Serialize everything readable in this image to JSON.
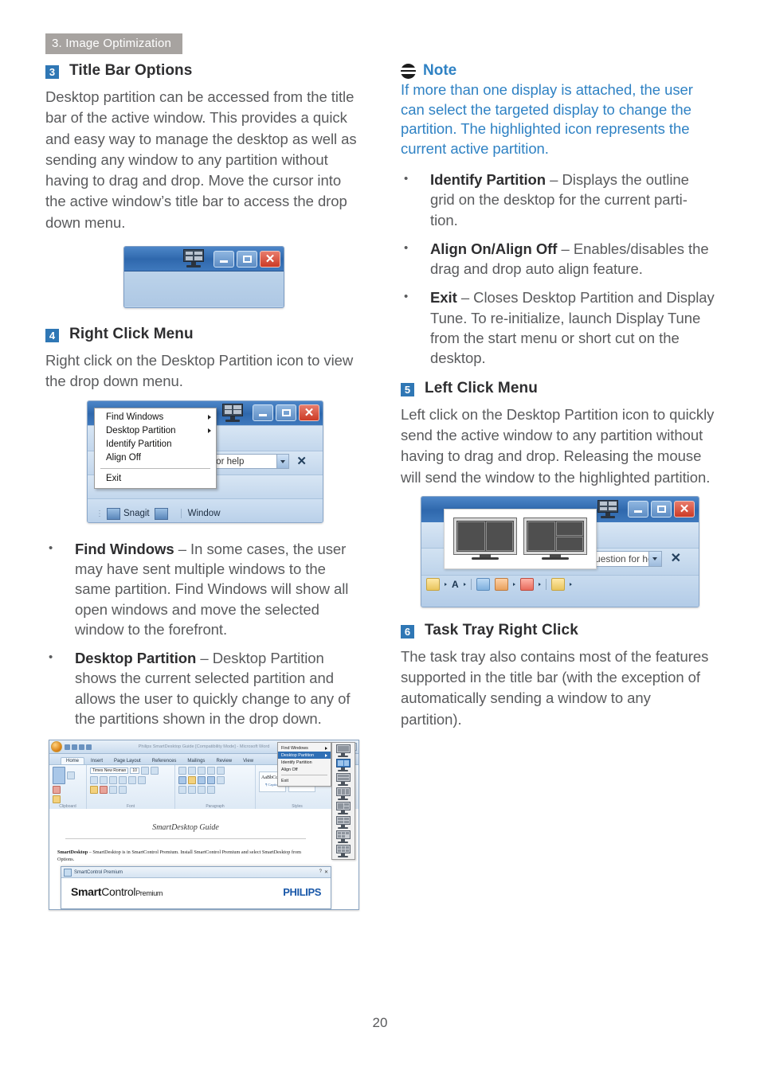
{
  "header": {
    "chapter": "3. Image Optimization"
  },
  "page": {
    "number": "20"
  },
  "colors": {
    "accent_blue": "#2f77b5",
    "note_blue": "#2f82c4",
    "header_gray": "#a7a3a0",
    "body_gray": "#5a5b5d"
  },
  "left_column": {
    "section_3": {
      "number": "3",
      "title": "Title Bar Options",
      "body": "Desktop partition can be accessed from the title bar of the active window.  This provides a quick and easy way to manage the desktop as well as sending any window to any partition without having to drag and drop.  Move the cursor into the active window’s title bar to access the drop down menu."
    },
    "figure_titlebar": {
      "monitor_icon": "monitor-partition-icon",
      "minimize_label": "–",
      "maximize_label": "□",
      "close_label": "✕"
    },
    "section_4": {
      "number": "4",
      "title": "Right Click Menu",
      "body": "Right click on the Desktop Partition icon to view the drop down menu."
    },
    "figure_rightclick": {
      "menu_items": [
        {
          "label": "Find Windows",
          "submenu": true
        },
        {
          "label": "Desktop Partition",
          "submenu": true
        },
        {
          "label": "Identify Partition",
          "submenu": false
        },
        {
          "label": "Align Off",
          "submenu": false
        },
        {
          "label": "Exit",
          "submenu": false
        }
      ],
      "help_box": "on for help",
      "close_glyph": "✕",
      "taskbar_app": "Snagit",
      "taskbar_item": "Window"
    },
    "bullets": [
      {
        "term": "Find Windows",
        "dash": " – ",
        "text": "In some cases, the user may have sent multiple windows to the same partition.  Find Windows will show all open windows and move the selected window to the forefront."
      },
      {
        "term": "Desktop Partition",
        "dash": " – ",
        "text": "Desktop Partition shows the current selected partition and allows the user to quickly change to any of the partitions shown in the drop down."
      }
    ],
    "figure_word": {
      "doc_title": "Philips SmartDesktop Guide [Compatibility Mode] - Microsoft Word",
      "ribbon_tabs": [
        "Home",
        "Insert",
        "Page Layout",
        "References",
        "Mailings",
        "Review",
        "View"
      ],
      "active_tab": "Home",
      "font_name": "Times New Roman",
      "font_size": "10",
      "group_labels": [
        "Clipboard",
        "Font",
        "Paragraph",
        "Styles"
      ],
      "paste_label": "Paste",
      "styles": [
        {
          "sample": "AaBbCcDd",
          "name": "¶ Caption"
        },
        {
          "sample": "AaBbCcI",
          "name": "Heading 1"
        }
      ],
      "submenu_items": [
        {
          "label": "Find Windows",
          "submenu": true,
          "highlighted": false
        },
        {
          "label": "Desktop Partition",
          "submenu": true,
          "highlighted": true
        },
        {
          "label": "Identify Partition",
          "submenu": false,
          "highlighted": false
        },
        {
          "label": "Align Off",
          "submenu": false,
          "highlighted": false
        },
        {
          "label": "Exit",
          "submenu": false,
          "highlighted": false
        }
      ],
      "document_heading": "SmartDesktop Guide",
      "document_paragraph_bold": "SmartDesktop",
      "document_paragraph": "– SmartDesktop is in SmartControl Premium.  Install SmartControl Premium and select SmartDesktop from Options.",
      "dialog": {
        "titlebar": "SmartControl Premium",
        "help_glyph": "?",
        "close_glyph": "✕",
        "product_a": "Smart",
        "product_b": "Control",
        "product_sup": "Premium",
        "brand": "PHILIPS"
      }
    }
  },
  "right_column": {
    "note": {
      "icon": "note-icon",
      "title": "Note",
      "body": "If more than one display is attached, the user can select the targeted display to change the partition. The highlighted icon represents the current active partition."
    },
    "bullets": [
      {
        "term": "Identify Partition",
        "dash": " – ",
        "text": "Displays the outline grid on the desktop for the current parti-tion."
      },
      {
        "term": "Align On/Align Off",
        "dash": " – ",
        "text": "Enables/disables the drag and drop auto align feature."
      },
      {
        "term": "Exit",
        "dash": " – ",
        "text": "Closes Desktop Partition and Display Tune.  To re-initialize, launch Display Tune from the start menu or short cut on the desktop."
      }
    ],
    "section_5": {
      "number": "5",
      "title": "Left Click Menu",
      "body": "Left click on the Desktop Partition icon to quickly send the active window to any partition without having to drag and drop. Releasing the mouse will send the window to the highlighted partition."
    },
    "figure_leftclick": {
      "help_box": "Type a question for help",
      "close_glyph": "✕",
      "partition_options": [
        "two-pane-vertical",
        "three-pane-mixed"
      ]
    },
    "section_6": {
      "number": "6",
      "title": "Task Tray Right Click",
      "body": "The task tray also contains most of the features supported in the title bar (with the exception of automatically sending a window to any partition)."
    }
  }
}
